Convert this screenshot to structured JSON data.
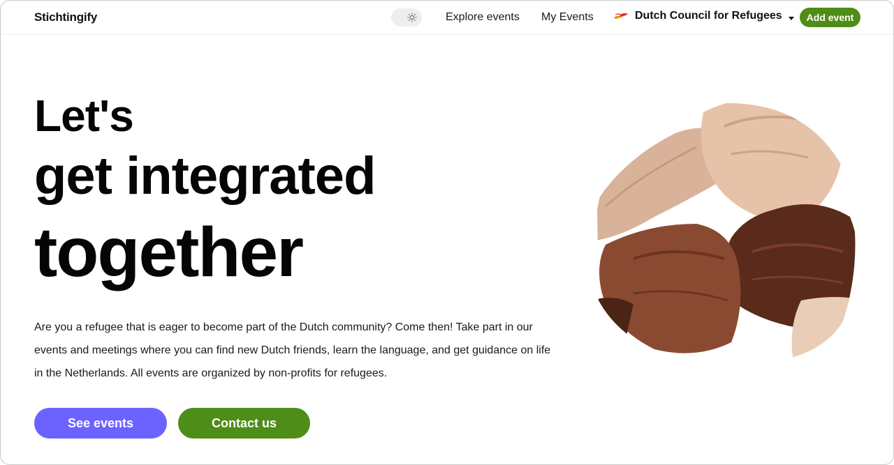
{
  "header": {
    "brand": "Stichtingify",
    "nav": [
      {
        "label": "Explore events"
      },
      {
        "label": "My Events"
      }
    ],
    "organization": {
      "name": "Dutch Council for Refugees"
    },
    "add_event_label": "Add event",
    "theme_icon": "sun-icon"
  },
  "hero": {
    "line1": "Let's",
    "line2": "get integrated",
    "line3": "together",
    "intro": "Are you a refugee that is eager to become part of the Dutch community? Come then! Take part in our events and meetings where you can find new Dutch friends, learn the language, and get guidance on life in the Netherlands. All events are organized by non-profits for refugees.",
    "primary_button": "See events",
    "secondary_button": "Contact us",
    "image_icon": "joined-hands-illustration"
  },
  "colors": {
    "accent_green": "#4e8d17",
    "accent_purple": "#6c63ff",
    "org_logo_red": "#e03131",
    "org_logo_orange": "#f08c00"
  }
}
